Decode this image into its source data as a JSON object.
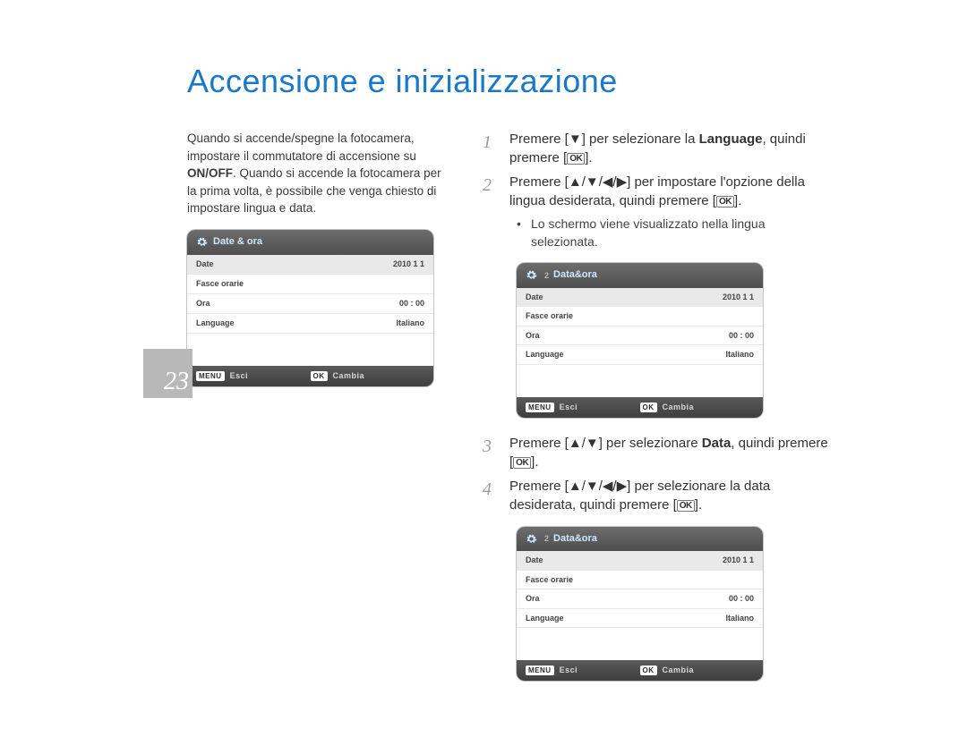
{
  "title": "Accensione e inizializzazione",
  "page_number": "23",
  "intro": {
    "t1": "Quando si accende/spegne la fotocamera, impostare il commutatore di accensione su ",
    "onoff": "ON/OFF",
    "t2": ". Quando si accende la fotocamera per la prima volta, è possibile che venga chiesto di impostare lingua e data."
  },
  "lcd_left": {
    "header": "Date & ora",
    "header_sub": "",
    "rows": [
      {
        "label": "Date",
        "value": "2010  1  1"
      },
      {
        "label": "Fasce orarie",
        "value": ""
      },
      {
        "label": "Ora",
        "value": "00 : 00"
      },
      {
        "label": "Language",
        "value": "Italiano"
      }
    ],
    "footer_left_tag": "MENU",
    "footer_left": "Esci",
    "footer_right_tag": "OK",
    "footer_right": "Cambia"
  },
  "steps": {
    "s1": {
      "pre": "Premere [▼] per selezionare la ",
      "bold": "Language",
      "post": ", quindi premere ["
    },
    "s2": {
      "text": "Premere [▲/▼/◀/▶] per impostare l'opzione della lingua desiderata, quindi premere ["
    },
    "bullet2": "Lo schermo viene visualizzato nella lingua selezionata.",
    "s3": {
      "pre": "Premere [▲/▼] per selezionare ",
      "bold": "Data",
      "post": ", quindi premere ["
    },
    "s4": {
      "text": "Premere [▲/▼/◀/▶] per selezionare la data desiderata, quindi premere ["
    }
  },
  "lcd_right1": {
    "header": "Data&ora",
    "header_sub": "2",
    "rows": [
      {
        "label": "Date",
        "value": "2010  1  1"
      },
      {
        "label": "Fasce orarie",
        "value": ""
      },
      {
        "label": "Ora",
        "value": "00 : 00"
      },
      {
        "label": "Language",
        "value": "Italiano"
      }
    ],
    "footer_left_tag": "MENU",
    "footer_left": "Esci",
    "footer_right_tag": "OK",
    "footer_right": "Cambia"
  },
  "lcd_right2": {
    "header": "Data&ora",
    "header_sub": "2",
    "rows": [
      {
        "label": "Date",
        "value": "2010  1  1"
      },
      {
        "label": "Fasce orarie",
        "value": ""
      },
      {
        "label": "Ora",
        "value": "00 : 00"
      },
      {
        "label": "Language",
        "value": "Italiano"
      }
    ],
    "footer_left_tag": "MENU",
    "footer_left": "Esci",
    "footer_right_tag": "OK",
    "footer_right": "Cambia"
  },
  "ok_key": "OK"
}
